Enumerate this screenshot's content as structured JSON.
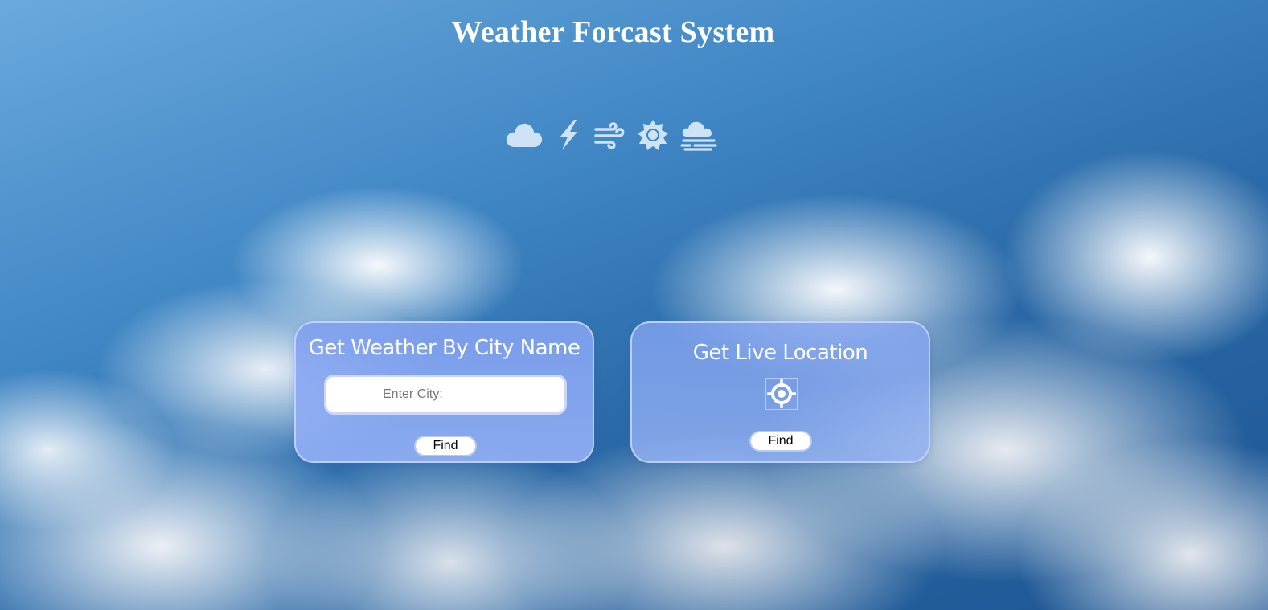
{
  "page": {
    "title": "Weather Forcast System"
  },
  "weather_icons": [
    {
      "name": "cloud-icon"
    },
    {
      "name": "lightning-icon"
    },
    {
      "name": "wind-icon"
    },
    {
      "name": "sun-icon"
    },
    {
      "name": "fog-icon"
    }
  ],
  "city_card": {
    "heading": "Get Weather By City Name",
    "input_placeholder": "Enter City:",
    "input_value": "",
    "find_label": "Find"
  },
  "live_card": {
    "heading": "Get Live Location",
    "icon": "crosshair-locate-icon",
    "find_label": "Find"
  },
  "colors": {
    "icon_color": "#cfe3f6",
    "card_bg": "#8ca9f2",
    "title_color": "#ffffff"
  }
}
